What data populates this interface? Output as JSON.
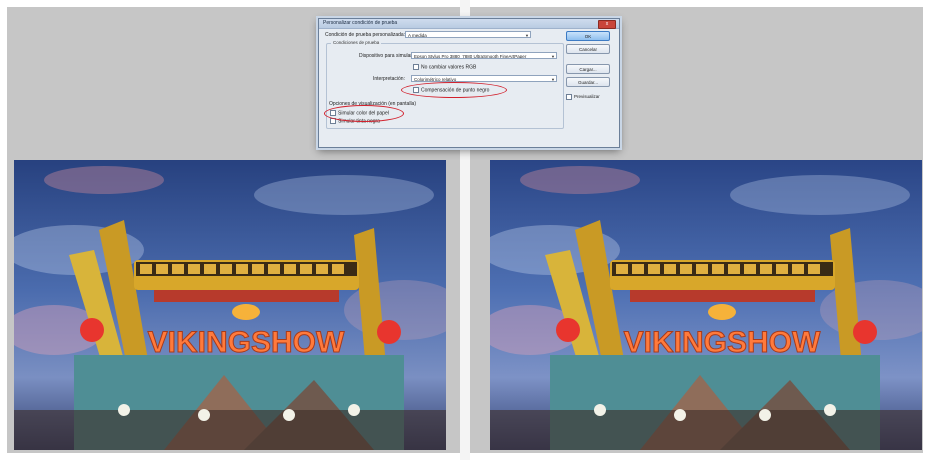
{
  "dialog": {
    "title": "Personalizar condición de prueba",
    "close_label": "x",
    "condition_label": "Condición de prueba personalizada:",
    "condition_value": "A medida",
    "group_title": "Condiciones de prueba",
    "device_label": "Dispositivo para simular:",
    "device_value": "Epson Stylus Pro 3880_7880 UltraSmooth FineArtPaper",
    "preserve_rgb_label": "No cambiar valores RGB",
    "intent_label": "Interpretación:",
    "intent_value": "Colorimétrico relativo",
    "black_point_label": "Compensación de punto negro",
    "display_options_label": "Opciones de visualización (en pantalla)",
    "simulate_paper_label": "Simular color del papel",
    "simulate_black_label": "Simular tinta negra",
    "ok_label": "OK",
    "cancel_label": "Cancelar",
    "load_label": "Cargar...",
    "save_label": "Guardar...",
    "preview_label": "Previsualizar"
  },
  "photos": {
    "left_sign": "VIKINGSHOW",
    "right_sign": "VIKINGSHOW"
  },
  "colors": {
    "sky_top": "#2d4a8f",
    "sky_mid": "#4a6fb5",
    "sign": "#ff7a3c",
    "highlight": "#d2202c"
  }
}
